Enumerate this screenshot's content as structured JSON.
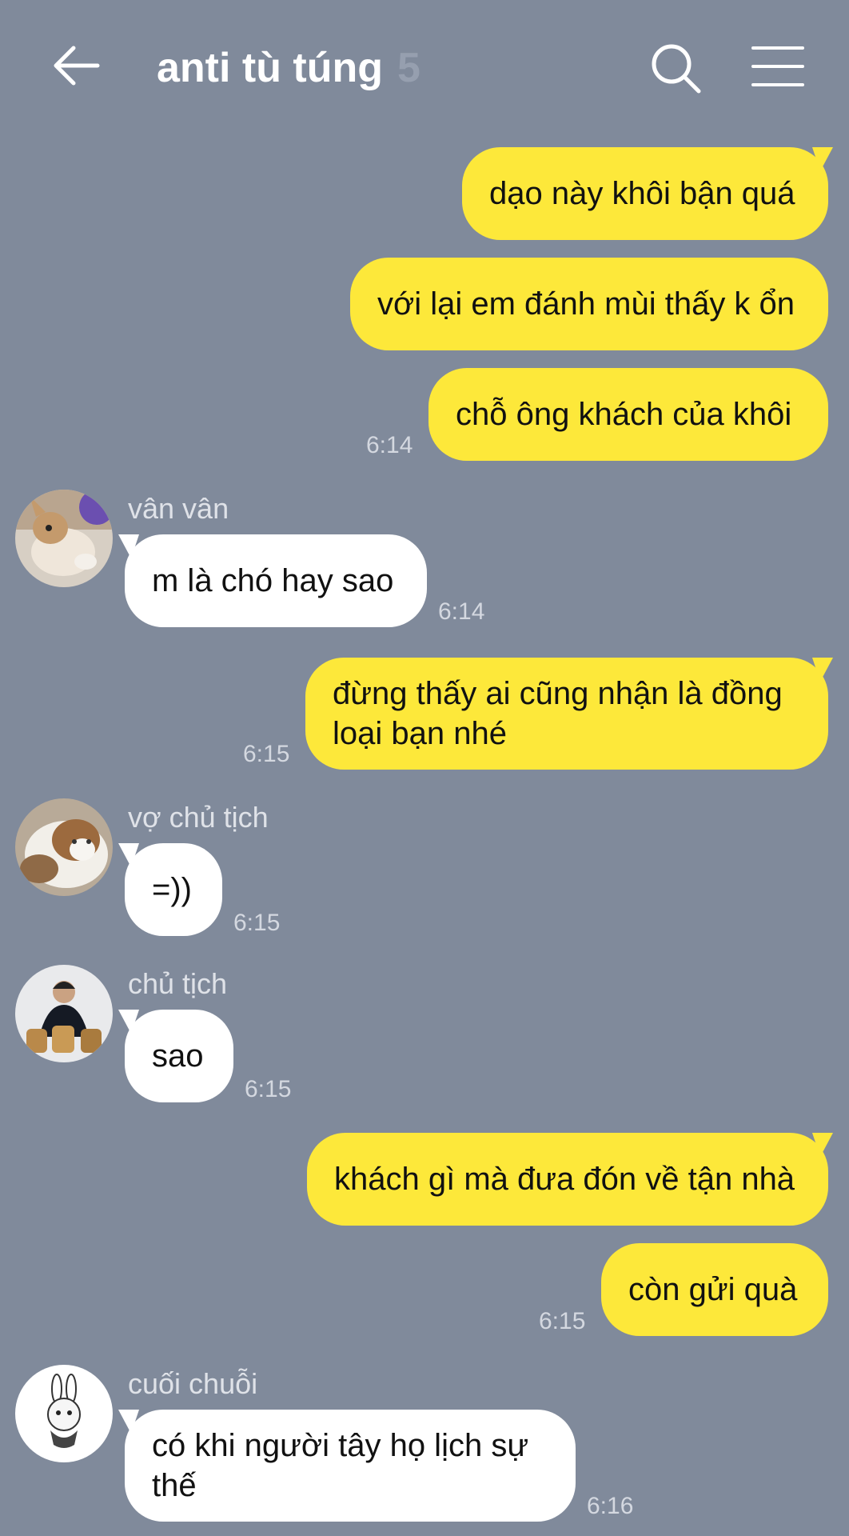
{
  "header": {
    "title": "anti tù túng",
    "member_count": "5",
    "icons": [
      "back-arrow-icon",
      "search-icon",
      "menu-icon"
    ]
  },
  "colors": {
    "background": "#808a9b",
    "my_bubble": "#fde83a",
    "their_bubble": "#ffffff",
    "title": "#ffffff"
  },
  "messages": [
    {
      "from": "me",
      "text": "dạo này khôi bận quá"
    },
    {
      "from": "me",
      "text": "với lại em đánh mùi thấy k ổn"
    },
    {
      "from": "me",
      "text": "chỗ ông khách của khôi",
      "time": "6:14"
    },
    {
      "from": "vân vân",
      "text": "m là chó hay sao",
      "time": "6:14"
    },
    {
      "from": "me",
      "text": "đừng thấy ai cũng nhận là đồng loại bạn nhé",
      "time": "6:15"
    },
    {
      "from": "vợ chủ tịch",
      "text": "=))",
      "time": "6:15"
    },
    {
      "from": "chủ tịch",
      "text": "sao",
      "time": "6:15"
    },
    {
      "from": "me",
      "text": "khách gì mà đưa đón về tận nhà"
    },
    {
      "from": "me",
      "text": "còn gửi quà",
      "time": "6:15"
    },
    {
      "from": "cuối chuỗi",
      "text": "có khi người tây họ lịch sự thế",
      "time": "6:16"
    }
  ]
}
